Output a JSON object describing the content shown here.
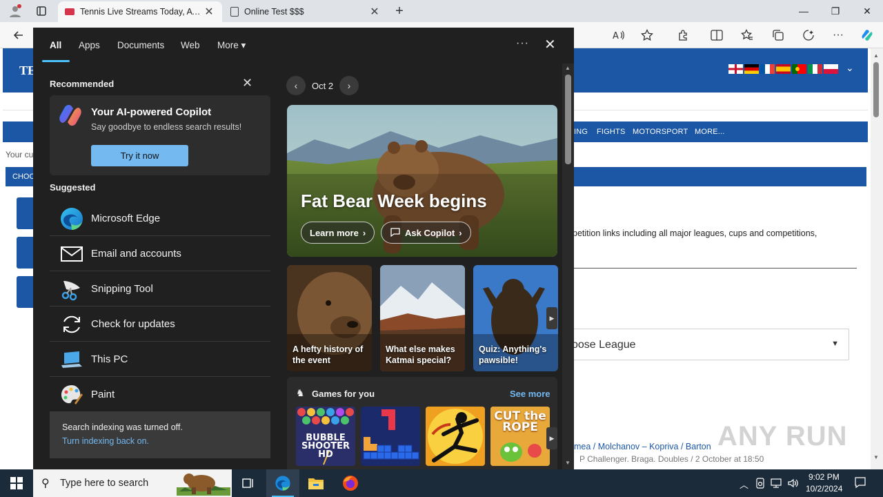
{
  "browser": {
    "tabs": [
      {
        "title": "Tennis Live Streams Today, ATP &",
        "favicon": "site-favicon",
        "active": true
      },
      {
        "title": "Online Test $$$",
        "favicon": "page-icon",
        "active": false
      }
    ],
    "new_tab": "+",
    "window_controls": {
      "minimize": "—",
      "restore": "❐",
      "close": "✕"
    }
  },
  "webpage": {
    "logo_text": "TE",
    "nav_items": [
      "ING",
      "FIGHTS",
      "MOTORSPORT",
      "MORE..."
    ],
    "your_text": "Your cu",
    "choose_text": "CHOO",
    "description": "petition links including all major leagues, cups and competitions,",
    "select_league": "oose League",
    "event_line": "mea / Molchanov – Kopriva / Barton",
    "event_meta": "P Challenger. Braga. Doubles / 2 October at 18:50",
    "watermark": "ANY RUN"
  },
  "panel": {
    "tabs": [
      "All",
      "Apps",
      "Documents",
      "Web",
      "More"
    ],
    "more_chevron": "▾",
    "options_icon": "···",
    "close_icon": "✕",
    "recommended_title": "Recommended",
    "copilot": {
      "title": "Your AI-powered Copilot",
      "subtitle": "Say goodbye to endless search results!",
      "button": "Try it now"
    },
    "suggested_title": "Suggested",
    "suggested": [
      {
        "label": "Microsoft Edge",
        "icon": "edge-icon"
      },
      {
        "label": "Email and accounts",
        "icon": "mail-icon"
      },
      {
        "label": "Snipping Tool",
        "icon": "snipping-tool-icon"
      },
      {
        "label": "Check for updates",
        "icon": "sync-icon"
      },
      {
        "label": "This PC",
        "icon": "computer-icon"
      },
      {
        "label": "Paint",
        "icon": "paint-icon"
      }
    ],
    "indexing": {
      "message": "Search indexing was turned off.",
      "link": "Turn indexing back on."
    },
    "date": "Oct 2",
    "hero": {
      "title": "Fat Bear Week begins",
      "learn_more": "Learn more",
      "ask_copilot": "Ask Copilot"
    },
    "thumbs": [
      {
        "caption": "A hefty history of the event"
      },
      {
        "caption": "What else makes Katmai special?"
      },
      {
        "caption": "Quiz: Anything's pawsible!"
      }
    ],
    "games": {
      "title": "Games for you",
      "see_more": "See more",
      "tiles": [
        {
          "label": "BUBBLE SHOOTER HD"
        },
        {
          "label": ""
        },
        {
          "label": ""
        },
        {
          "label": "CUT the ROPE"
        }
      ]
    }
  },
  "taskbar": {
    "search_placeholder": "Type here to search",
    "time": "9:02 PM",
    "date": "10/2/2024"
  }
}
